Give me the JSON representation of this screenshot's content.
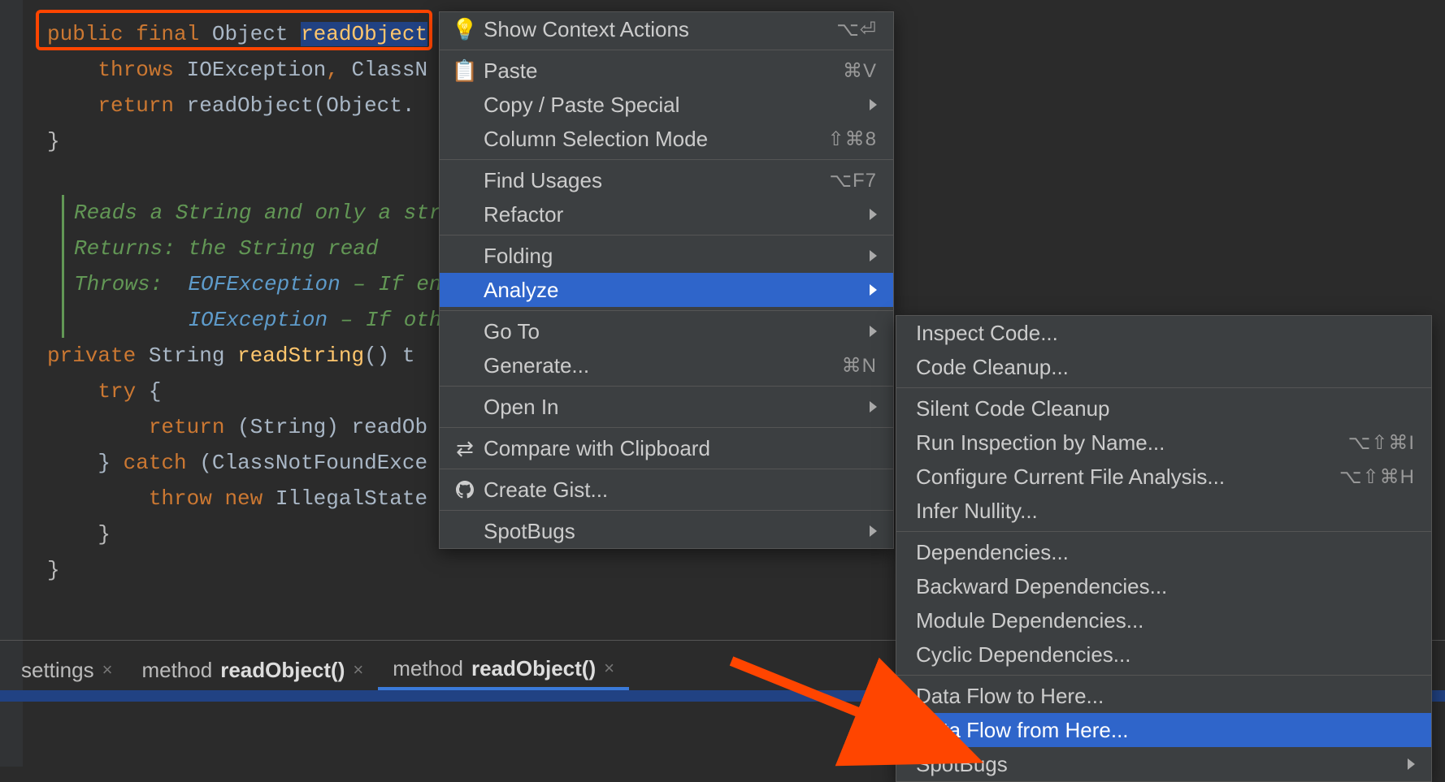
{
  "code": {
    "l1": {
      "public": "public ",
      "final": "final ",
      "type": "Object ",
      "method": "readObject"
    },
    "l2": {
      "throws": "throws ",
      "ex1": "IOException",
      "comma": ", ",
      "ex2": "ClassN"
    },
    "l3": {
      "return": "return ",
      "call": "readObject",
      "paren": "(Object."
    },
    "l4": "}",
    "doc1": "Reads a String and only a string.",
    "doc2a": "Returns: ",
    "doc2b": "the String read",
    "doc3a": "Throws:  ",
    "doc3b": "EOFException",
    "doc3c": " – If end o",
    "doc4b": "IOException",
    "doc4c": " – If other ",
    "l5": {
      "private": "private ",
      "type": "String ",
      "method": "readString",
      "rest": "() t"
    },
    "l6": {
      "try": "try ",
      "brace": "{"
    },
    "l7": {
      "return": "return ",
      "cast": "(String) ",
      "call": "readOb"
    },
    "l8": {
      "brace": "} ",
      "catch": "catch ",
      "paren": "(ClassNotFoundExce"
    },
    "l9": {
      "throw": "throw ",
      "new": "new ",
      "type": "IllegalState"
    },
    "l10": "}",
    "l11": "}"
  },
  "tabs": {
    "t1": "settings",
    "t2a": "method ",
    "t2b": "readObject()",
    "t3a": "method ",
    "t3b": "readObject()"
  },
  "menu": {
    "m1": {
      "label": "Show Context Actions",
      "shortcut": "⌥⏎"
    },
    "m2": {
      "label": "Paste",
      "shortcut": "⌘V"
    },
    "m3": {
      "label": "Copy / Paste Special"
    },
    "m4": {
      "label": "Column Selection Mode",
      "shortcut": "⇧⌘8"
    },
    "m5": {
      "label": "Find Usages",
      "shortcut": "⌥F7"
    },
    "m6": {
      "label": "Refactor"
    },
    "m7": {
      "label": "Folding"
    },
    "m8": {
      "label": "Analyze"
    },
    "m9": {
      "label": "Go To"
    },
    "m10": {
      "label": "Generate...",
      "shortcut": "⌘N"
    },
    "m11": {
      "label": "Open In"
    },
    "m12": {
      "label": "Compare with Clipboard"
    },
    "m13": {
      "label": "Create Gist..."
    },
    "m14": {
      "label": "SpotBugs"
    }
  },
  "submenu": {
    "s1": "Inspect Code...",
    "s2": "Code Cleanup...",
    "s3": "Silent Code Cleanup",
    "s4": {
      "label": "Run Inspection by Name...",
      "shortcut": "⌥⇧⌘I"
    },
    "s5": {
      "label": "Configure Current File Analysis...",
      "shortcut": "⌥⇧⌘H"
    },
    "s6": "Infer Nullity...",
    "s7": "Dependencies...",
    "s8": "Backward Dependencies...",
    "s9": "Module Dependencies...",
    "s10": "Cyclic Dependencies...",
    "s11": "Data Flow to Here...",
    "s12": "Data Flow from Here...",
    "s13": "SpotBugs"
  }
}
